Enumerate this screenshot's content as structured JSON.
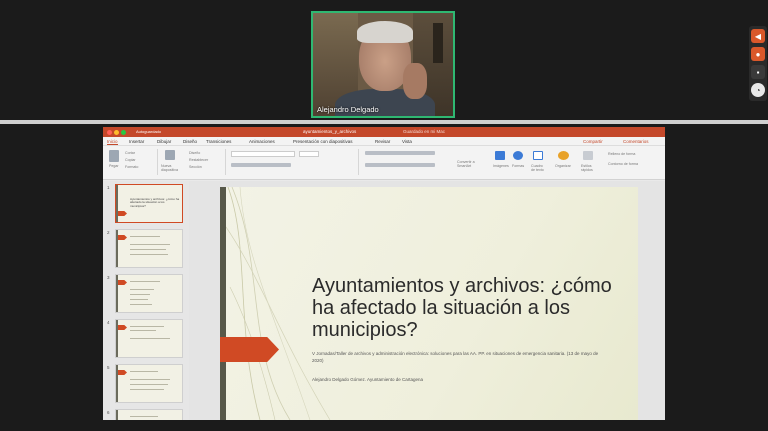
{
  "video": {
    "participant_name": "Alejandro Delgado"
  },
  "right_toolbar": {
    "buttons": [
      "arrow-left-icon",
      "microphone-icon",
      "camera-icon",
      "chat-icon"
    ]
  },
  "powerpoint": {
    "titlebar": {
      "autosave_label": "Autoguardado",
      "document_title": "ayuntamientos_y_archivos",
      "save_status": "Guardado en mi Mac"
    },
    "menu": {
      "items": [
        "Inicio",
        "Insertar",
        "Dibujar",
        "Diseño",
        "Transiciones",
        "Animaciones",
        "Presentación con diapositivas",
        "Revisar",
        "Vista"
      ],
      "share_label": "Compartir",
      "comments_label": "Comentarios"
    },
    "ribbon": {
      "paste": "Pegar",
      "cut": "Cortar",
      "copy": "Copiar",
      "format": "Formato",
      "new_slide": "Nueva diapositiva",
      "layout": "Diseño",
      "reset": "Restablecer",
      "section": "Sección",
      "images": "Imágenes",
      "shapes": "Formas",
      "text_box": "Cuadro de texto",
      "arrange": "Organizar",
      "quick_styles": "Estilos rápidos",
      "convert_smartart": "Convertir a SmartArt",
      "shape_fill": "Relleno de forma",
      "shape_outline": "Contorno de forma"
    },
    "thumbnails": [
      {
        "number": "1",
        "title": "Ayuntamientos y archivos: ¿cómo ha afectado la situación a los municipios?"
      },
      {
        "number": "2",
        "title": ""
      },
      {
        "number": "3",
        "title": ""
      },
      {
        "number": "4",
        "title": ""
      },
      {
        "number": "5",
        "title": ""
      },
      {
        "number": "6",
        "title": ""
      }
    ],
    "slide": {
      "title": "Ayuntamientos y archivos: ¿cómo ha afectado la situación a los municipios?",
      "subtitle": "V Jornadas/Taller de archivos y administración electrónica: soluciones para las AA. PP. en situaciones de emergencia sanitaria. (13 de mayo de 2020)",
      "author": "Alejandro Delgado Gómez. Ayuntamiento de Cartagena"
    },
    "colors": {
      "accent": "#d04a24",
      "titlebar": "#c4482a"
    }
  }
}
